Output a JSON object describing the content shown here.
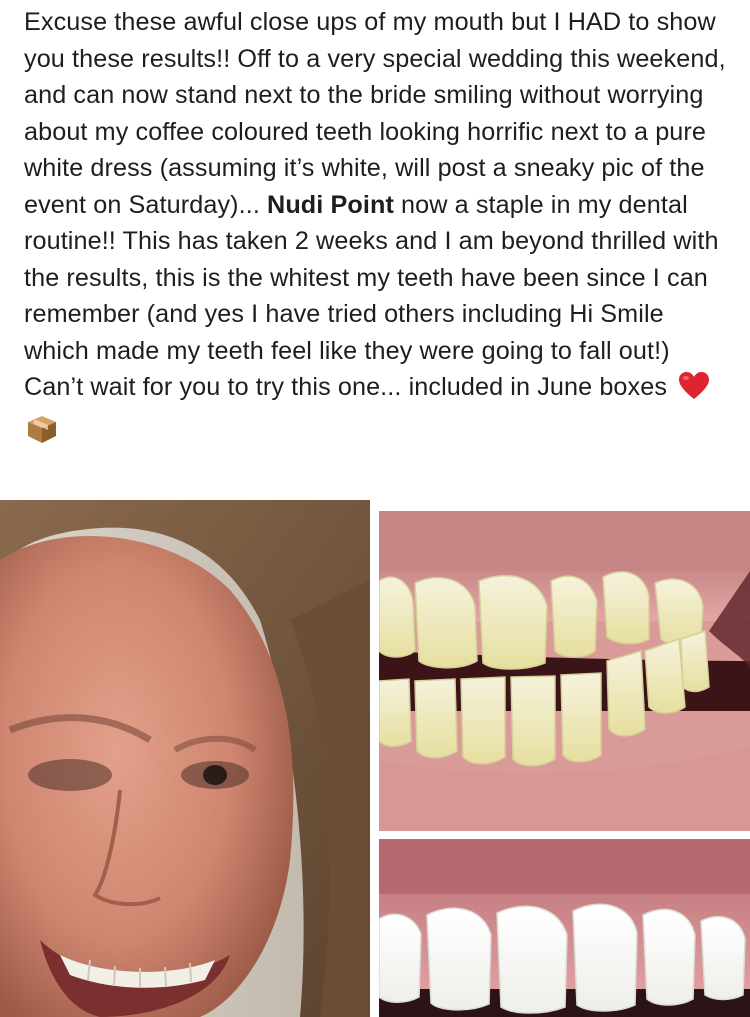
{
  "post": {
    "text_before_bold": "Excuse these awful close ups of my mouth but I HAD to show you these results!! Off to a very special wedding this weekend, and can now stand next to the bride smiling without worrying about my coffee coloured teeth looking horrific next to a pure white dress (assuming it’s white, will post a sneaky pic of the event on Saturday)... ",
    "bold_brand": "Nudi Point",
    "text_after_bold": " now a staple in my dental routine!! This has taken 2 weeks and I am beyond thrilled with the results, this is the whitest my teeth have been since I can remember (and yes I have tried others including Hi Smile which made my teeth feel like they were going to fall out!) Can’t wait for you to try this one... included in June boxes",
    "emojis": [
      "red-heart-icon",
      "package-box-icon"
    ]
  },
  "colors": {
    "text": "#1c1e21",
    "heart": "#e0242f",
    "box": "#b07a43"
  }
}
